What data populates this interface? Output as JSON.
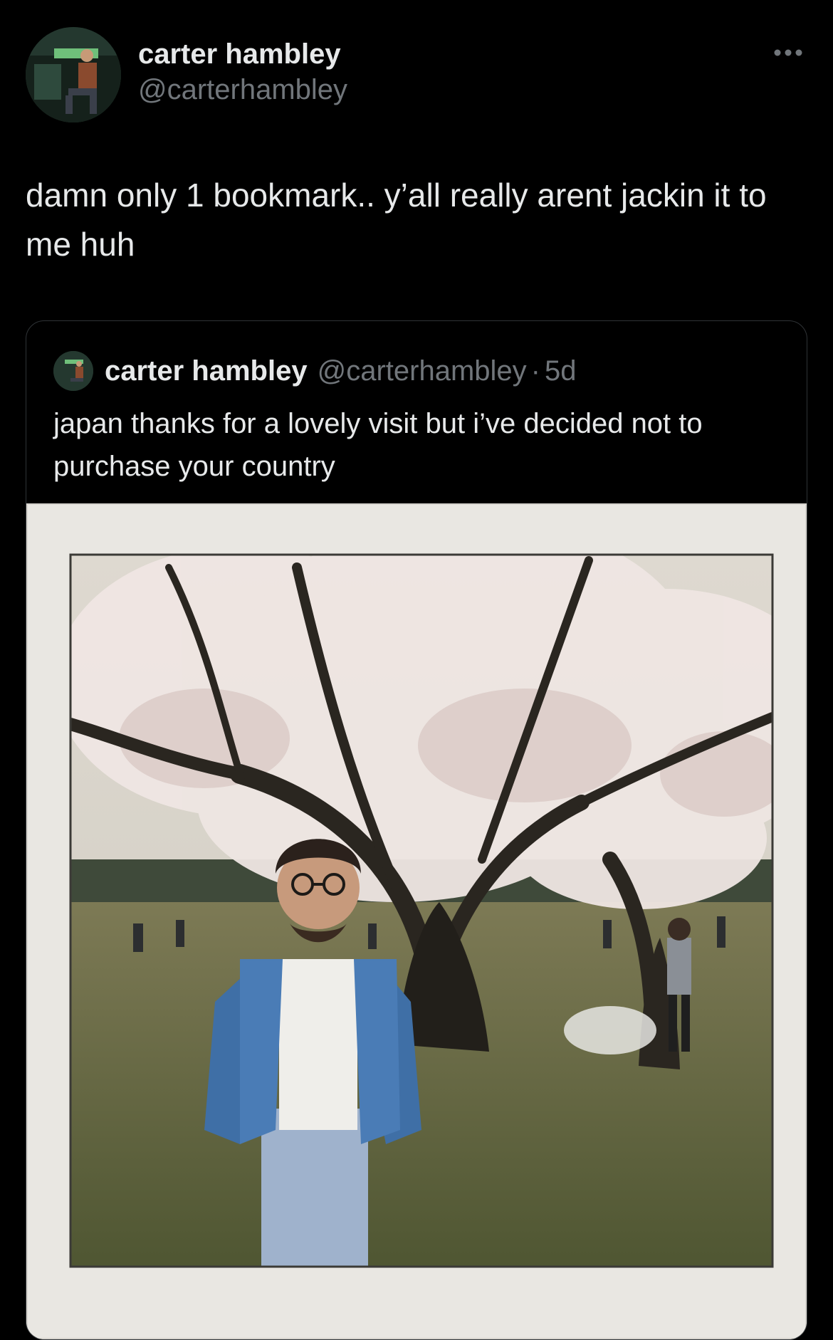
{
  "author": {
    "display_name": "carter hambley",
    "handle": "@carterhambley"
  },
  "tweet": {
    "text": "damn only 1 bookmark.. y’all really arent jackin it to me huh"
  },
  "quoted_tweet": {
    "display_name": "carter hambley",
    "handle": "@carterhambley",
    "separator": "·",
    "timestamp": "5d",
    "text": "japan thanks for a lovely visit but i’ve decided not to purchase your country"
  },
  "icons": {
    "more": "more-horizontal-icon"
  },
  "colors": {
    "background": "#000000",
    "text_primary": "#e7e9ea",
    "text_secondary": "#71767b",
    "border": "#2f3336"
  }
}
